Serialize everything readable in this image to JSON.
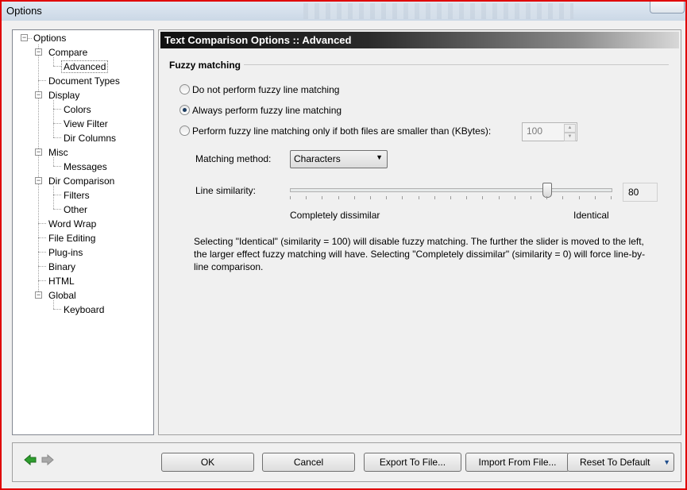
{
  "window": {
    "title": "Options"
  },
  "tree": {
    "root": "Options",
    "items": [
      {
        "label": "Compare",
        "level": 1,
        "expander": "minus"
      },
      {
        "label": "Advanced",
        "level": 2,
        "selected": true
      },
      {
        "label": "Document Types",
        "level": 1
      },
      {
        "label": "Display",
        "level": 1,
        "expander": "minus"
      },
      {
        "label": "Colors",
        "level": 2
      },
      {
        "label": "View Filter",
        "level": 2
      },
      {
        "label": "Dir Columns",
        "level": 2
      },
      {
        "label": "Misc",
        "level": 1,
        "expander": "minus"
      },
      {
        "label": "Messages",
        "level": 2
      },
      {
        "label": "Dir Comparison",
        "level": 1,
        "expander": "minus"
      },
      {
        "label": "Filters",
        "level": 2
      },
      {
        "label": "Other",
        "level": 2
      },
      {
        "label": "Word Wrap",
        "level": 1
      },
      {
        "label": "File Editing",
        "level": 1
      },
      {
        "label": "Plug-ins",
        "level": 1
      },
      {
        "label": "Binary",
        "level": 1
      },
      {
        "label": "HTML",
        "level": 1
      },
      {
        "label": "Global",
        "level": 1,
        "expander": "minus"
      },
      {
        "label": "Keyboard",
        "level": 2
      }
    ]
  },
  "panel": {
    "header": "Text Comparison Options :: Advanced",
    "group_title": "Fuzzy matching",
    "radios": [
      {
        "label": "Do not perform fuzzy line matching",
        "checked": false
      },
      {
        "label": "Always perform fuzzy line matching",
        "checked": true
      },
      {
        "label": "Perform fuzzy line matching only if both files are smaller than (KBytes):",
        "checked": false
      }
    ],
    "size_limit": "100",
    "matching_method_label": "Matching method:",
    "matching_method_value": "Characters",
    "similarity_label": "Line similarity:",
    "similarity_value": "80",
    "similarity_min_label": "Completely dissimilar",
    "similarity_max_label": "Identical",
    "description": "Selecting \"Identical\" (similarity = 100) will disable fuzzy matching. The further the slider is moved to the left, the larger effect fuzzy matching will have. Selecting \"Completely dissimilar\" (similarity = 0) will force line-by-line comparison."
  },
  "buttons": {
    "ok": "OK",
    "cancel": "Cancel",
    "export": "Export To File...",
    "import": "Import From File...",
    "reset": "Reset To Default"
  },
  "icons": {
    "back": "left-arrow-icon",
    "forward": "right-arrow-icon"
  },
  "colors": {
    "back_arrow": "#2e9e2e",
    "forward_arrow": "#9a9a9a"
  }
}
